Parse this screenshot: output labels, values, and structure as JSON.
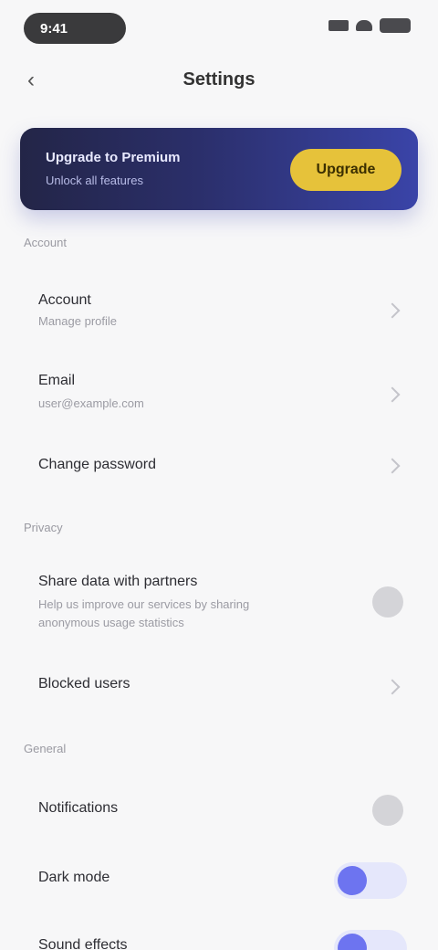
{
  "status_bar": {
    "time": "9:41"
  },
  "nav": {
    "back_icon": "chevron-left-icon",
    "title": "Settings"
  },
  "promo": {
    "title": "Upgrade to Premium",
    "subtitle": "Unlock all features",
    "button_label": "Upgrade",
    "colors": {
      "start": "#232547",
      "end": "#3a44a8",
      "button": "#e6c23a"
    }
  },
  "sections": {
    "account": {
      "label": "Account",
      "items": [
        {
          "title": "Account",
          "subtitle": "Manage profile"
        },
        {
          "title": "Email",
          "subtitle": "user@example.com"
        },
        {
          "title": "Change password"
        }
      ]
    },
    "privacy": {
      "label": "Privacy",
      "items": [
        {
          "title": "Share data with partners",
          "subtitle": "Help us improve our services by sharing",
          "subtitle2": "anonymous usage statistics"
        },
        {
          "title": "Blocked users"
        }
      ]
    },
    "general": {
      "label": "General",
      "items": [
        {
          "title": "Notifications",
          "state": "off"
        },
        {
          "title": "Dark mode",
          "state": "on"
        },
        {
          "title": "Sound effects",
          "state": "on"
        }
      ]
    }
  }
}
